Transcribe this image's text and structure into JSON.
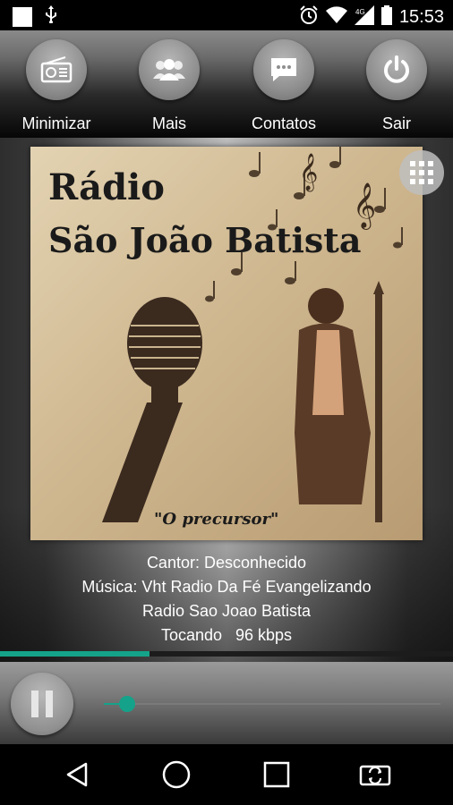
{
  "status_bar": {
    "time": "15:53",
    "icons": [
      "notification-square-icon",
      "usb-icon",
      "alarm-icon",
      "wifi-icon",
      "signal-4g-icon",
      "battery-icon"
    ]
  },
  "toolbar": {
    "buttons": [
      {
        "label": "Minimizar",
        "icon": "radio-icon"
      },
      {
        "label": "Mais",
        "icon": "people-icon"
      },
      {
        "label": "Contatos",
        "icon": "chat-icon"
      },
      {
        "label": "Sair",
        "icon": "power-icon"
      }
    ]
  },
  "cover": {
    "title_line1": "Rádio",
    "title_line2": "São João Batista",
    "subtitle": "\"O precursor\"",
    "grid_icon": "grid-menu-icon"
  },
  "info": {
    "singer": "Cantor: Desconhecido",
    "song": "Música: Vht Radio Da Fé Evangelizando",
    "station": "Radio Sao Joao Batista",
    "status": "Tocando   96 kbps"
  },
  "progress": {
    "fraction": 0.33
  },
  "player": {
    "volume_fraction": 0.07,
    "pause_icon": "pause-icon"
  },
  "nav": [
    "back-icon",
    "home-icon",
    "recents-icon",
    "screen-rotate-icon"
  ],
  "colors": {
    "accent": "#14a38a"
  }
}
